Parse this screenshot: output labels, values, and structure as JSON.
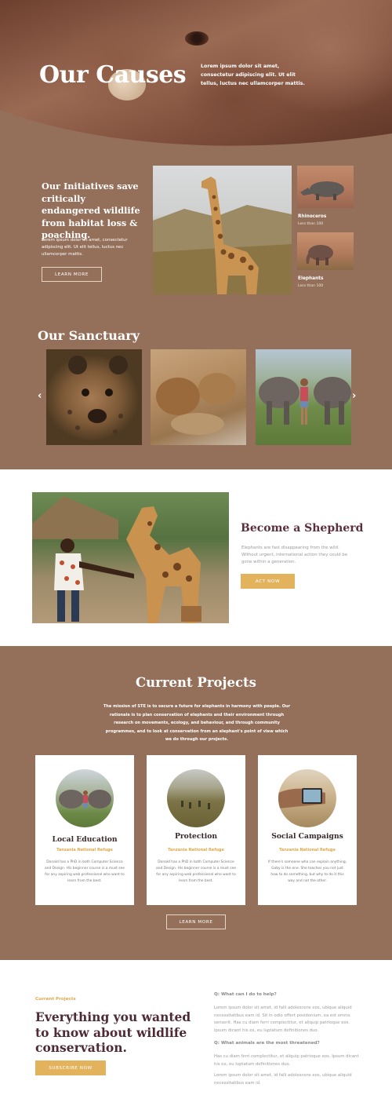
{
  "hero": {
    "title": "Our Causes",
    "text": "Lorem ipsum dolor sit amet, consectetur adipiscing elit. Ut elit tellus, luctus nec ullamcorper mattis."
  },
  "initiatives": {
    "title": "Our Initiatives save critically endangered wildlife from habitat loss & poaching.",
    "text": "Lorem ipsum dolor sit amet, consectetur adipiscing elit. Ut elit tellus, luctus nec ullamcorper mattis.",
    "button": "LEARN MORE",
    "animals": [
      {
        "name": "Rhinoceros",
        "sub": "Less than 100"
      },
      {
        "name": "Elephants",
        "sub": "Less than 100"
      }
    ]
  },
  "sanctuary": {
    "title": "Our Sanctuary",
    "prev_icon": "‹",
    "next_icon": "›"
  },
  "shepherd": {
    "title": "Become a Shepherd",
    "text": "Elephants are fast disappearing from the wild. Without urgent, international action they could be gone within a generation.",
    "button": "ACT NOW"
  },
  "projects": {
    "title": "Current Projects",
    "text": "The mission of STE is to secure a future for elephants in harmony with people. Our rationale is to plan conservation of elephants and their environment through research on movements, ecology, and behaviour, and through community programmes, and to look at conservation from an elephant's point of view which we do through our projects.",
    "cards": [
      {
        "title": "Local Education",
        "sub": "Tanzania National Refuge",
        "text": "Donald has a PhD in both Computer Science and Design. His beginner course is a must see for any aspiring web professional who want to learn from the best."
      },
      {
        "title": "Protection",
        "sub": "Tanzania National Refuge",
        "text": "Donald has a PhD in both Computer Science and Design. His beginner course is a must see for any aspiring web professional who want to learn from the best."
      },
      {
        "title": "Social Campaigns",
        "sub": "Tanzania National Refuge",
        "text": "If there's someone who can explain anything, Gaby is the one. She teaches you not just how to do something, but why to do it this way and not the other."
      }
    ],
    "button": "LEARN MORE"
  },
  "faq": {
    "kicker": "Current Projects",
    "title": "Everything you wanted to know about wildlife conservation.",
    "button": "SUBSCRIBE NOW",
    "q1": "Q: What can I do to help?",
    "a1": "Lorem ipsum dolor sit amet, id falli adolescens eos, ubique aliquid necessitatibus eam id. Sit in odio offert posidonium, ea est omnis senserit. Has cu diam ferri complectitur, et aliquip patrioque eos. Ipsum dicant his ex, eu luptatum definitiones duo.",
    "q2": "Q: What animals are the most threatened?",
    "a2": "Has cu diam ferri complectitur, et aliquip patrioque eos. Ipsum dicant his ex, eu luptatum definitiones duo.",
    "a3": "Lorem ipsum dolor sit amet, id falli adolescens eos, ubique aliquid necessitatibus eam id."
  },
  "colors": {
    "brown": "#94705b",
    "accent": "#e3b25d",
    "plum": "#5c2f3f"
  }
}
